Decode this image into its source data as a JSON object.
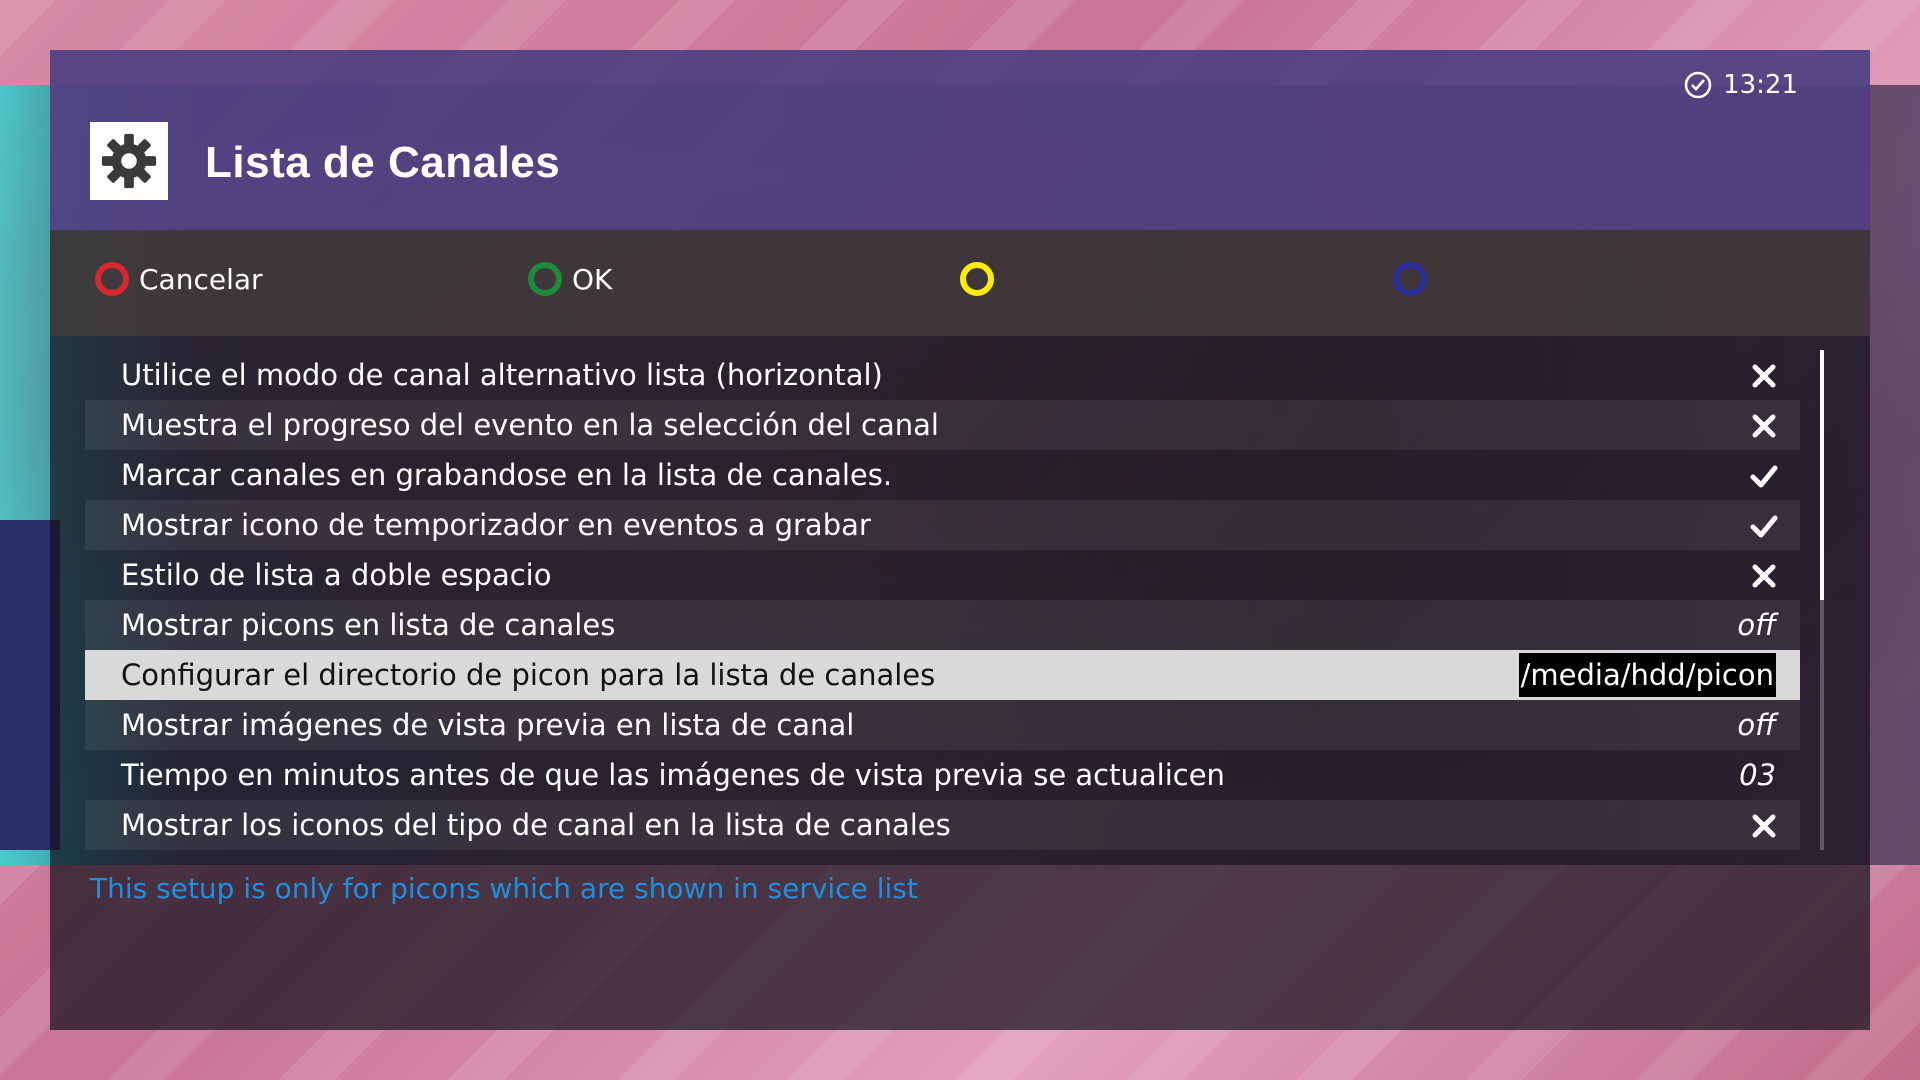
{
  "header": {
    "title": "Lista de Canales",
    "icon": "gear-icon",
    "clock": "13:21"
  },
  "buttons": [
    {
      "label": "Cancelar",
      "color": "#d9262e",
      "key": "red"
    },
    {
      "label": "OK",
      "color": "#1f8a3a",
      "key": "green"
    },
    {
      "label": "",
      "color": "#ffee00",
      "key": "yellow"
    },
    {
      "label": "",
      "color": "#2a2f9a",
      "key": "blue"
    }
  ],
  "settings": [
    {
      "label": "Utilice el modo de canal alternativo lista (horizontal)",
      "type": "toggle",
      "state": "off"
    },
    {
      "label": "Muestra el progreso del evento en la selección del canal",
      "type": "toggle",
      "state": "off"
    },
    {
      "label": "Marcar canales en grabandose en la lista de canales.",
      "type": "toggle",
      "state": "on"
    },
    {
      "label": "Mostrar icono de temporizador en eventos a grabar",
      "type": "toggle",
      "state": "on"
    },
    {
      "label": "Estilo de lista a doble espacio",
      "type": "toggle",
      "state": "off"
    },
    {
      "label": "Mostrar picons en lista de canales",
      "type": "text",
      "value": "off"
    },
    {
      "label": "Configurar el directorio de picon para la lista de canales",
      "type": "text",
      "value": "/media/hdd/picon",
      "selected": true
    },
    {
      "label": "Mostrar imágenes de vista previa en lista de canal",
      "type": "text",
      "value": "off"
    },
    {
      "label": "Tiempo en minutos antes de que las imágenes de vista previa se actualicen",
      "type": "text",
      "value": "03"
    },
    {
      "label": "Mostrar los iconos del tipo de canal en la lista de canales",
      "type": "toggle",
      "state": "off"
    }
  ],
  "help_text": "This setup is only for picons which are shown in service list",
  "scroll": {
    "position_fraction": 0.0,
    "visible_fraction": 0.5
  }
}
